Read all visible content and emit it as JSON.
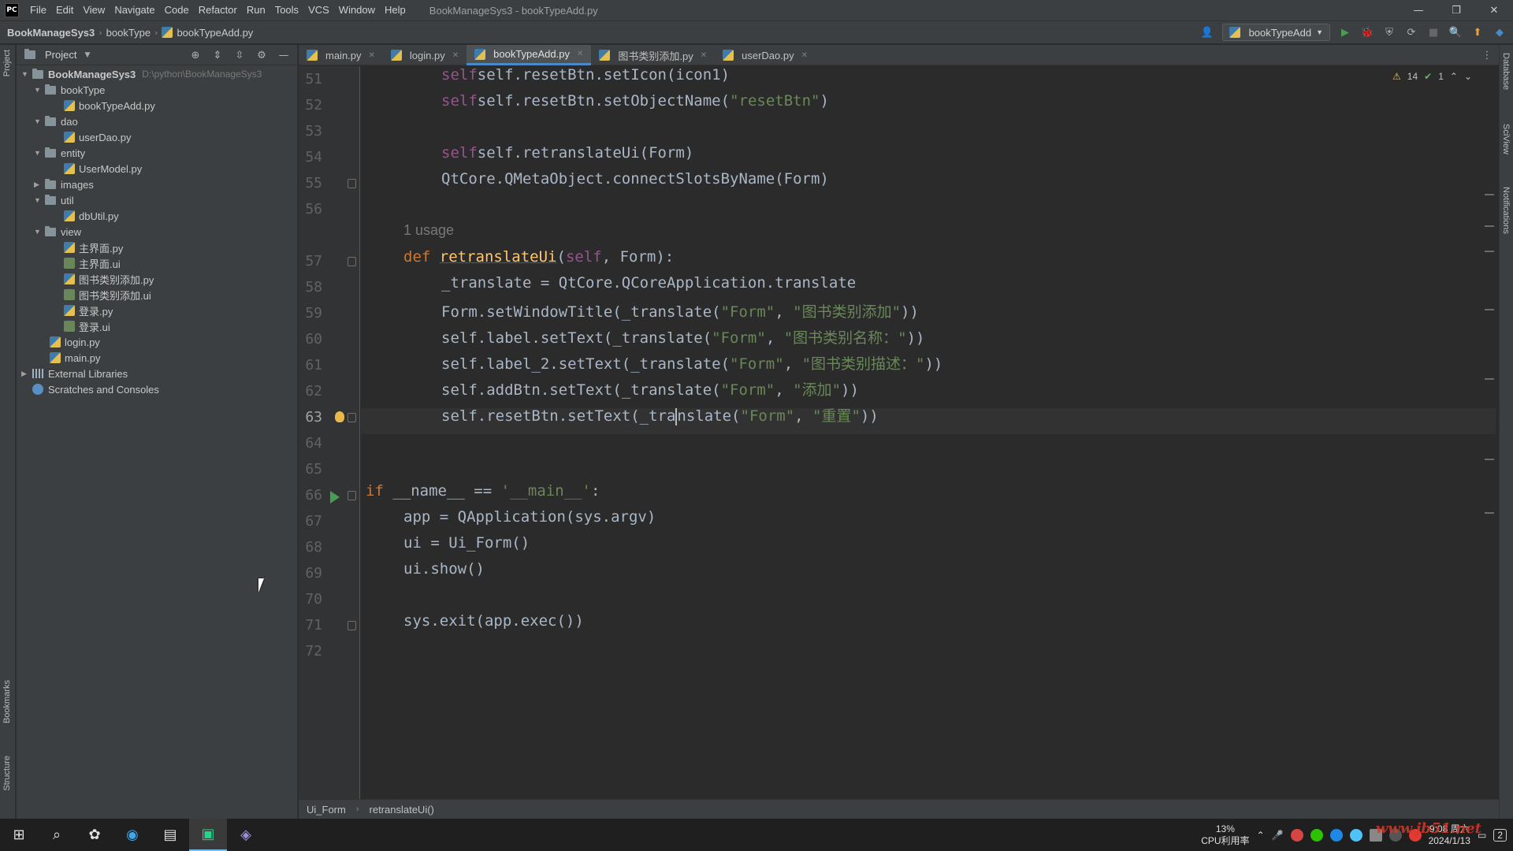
{
  "titlebar": {
    "logo": "PC",
    "menu": [
      "File",
      "Edit",
      "View",
      "Navigate",
      "Code",
      "Refactor",
      "Run",
      "Tools",
      "VCS",
      "Window",
      "Help"
    ],
    "window_title": "BookManageSys3 - bookTypeAdd.py",
    "controls": [
      "—",
      "❐",
      "✕"
    ]
  },
  "navbar": {
    "crumbs": [
      "BookManageSys3",
      "bookType",
      "bookTypeAdd.py"
    ],
    "run_config": "bookTypeAdd"
  },
  "left_stripe": {
    "project": "Project",
    "bookmarks": "Bookmarks",
    "structure": "Structure"
  },
  "right_stripe": {
    "database": "Database",
    "sciview": "SciView",
    "notifications": "Notifications"
  },
  "project": {
    "header": "Project",
    "root": {
      "name": "BookManageSys3",
      "path": "D:\\python\\BookManageSys3"
    },
    "tree": [
      {
        "label": "bookType",
        "kind": "folder",
        "open": true
      },
      {
        "label": "bookTypeAdd.py",
        "kind": "py"
      },
      {
        "label": "dao",
        "kind": "folder",
        "open": true
      },
      {
        "label": "userDao.py",
        "kind": "py"
      },
      {
        "label": "entity",
        "kind": "folder",
        "open": true
      },
      {
        "label": "UserModel.py",
        "kind": "py"
      },
      {
        "label": "images",
        "kind": "folder",
        "open": false
      },
      {
        "label": "util",
        "kind": "folder",
        "open": true
      },
      {
        "label": "dbUtil.py",
        "kind": "py"
      },
      {
        "label": "view",
        "kind": "folder",
        "open": true
      },
      {
        "label": "主界面.py",
        "kind": "py"
      },
      {
        "label": "主界面.ui",
        "kind": "ui"
      },
      {
        "label": "图书类别添加.py",
        "kind": "py"
      },
      {
        "label": "图书类别添加.ui",
        "kind": "ui"
      },
      {
        "label": "登录.py",
        "kind": "py"
      },
      {
        "label": "登录.ui",
        "kind": "ui"
      },
      {
        "label": "login.py",
        "kind": "py"
      },
      {
        "label": "main.py",
        "kind": "py"
      },
      {
        "label": "External Libraries",
        "kind": "lib"
      },
      {
        "label": "Scratches and Consoles",
        "kind": "scratch"
      }
    ]
  },
  "tabs": [
    {
      "label": "main.py",
      "active": false
    },
    {
      "label": "login.py",
      "active": false
    },
    {
      "label": "bookTypeAdd.py",
      "active": true
    },
    {
      "label": "图书类别添加.py",
      "active": false
    },
    {
      "label": "userDao.py",
      "active": false
    }
  ],
  "inspections": {
    "warnings": "14",
    "ok": "1"
  },
  "editor": {
    "line_numbers": [
      "51",
      "52",
      "53",
      "54",
      "55",
      "56",
      "57",
      "58",
      "59",
      "60",
      "61",
      "62",
      "63",
      "64",
      "65",
      "66",
      "67",
      "68",
      "69",
      "70",
      "71",
      "72"
    ],
    "current_line": "63",
    "usage_hint": "1 usage",
    "code": {
      "l51": "self.resetBtn.setIcon(icon1)",
      "l52a": "self.resetBtn.setObjectName(",
      "l52s": "\"resetBtn\"",
      "l52b": ")",
      "l54": "self.retranslateUi(Form)",
      "l55": "QtCore.QMetaObject.connectSlotsByName(Form)",
      "l57": "retranslateUi(self, Form):",
      "l58": "_translate = QtCore.QCoreApplication.translate",
      "l59a": "Form.setWindowTitle(_translate(",
      "l59s1": "\"Form\"",
      "l59s2": "\"图书类别添加\"",
      "l60a": "self.label.setText(_translate(",
      "l60s2": "\"图书类别名称：\"",
      "l61a": "self.label_2.setText(_translate(",
      "l61s2": "\"图书类别描述：\"",
      "l62a": "self.addBtn.setText(_translate(",
      "l62s2": "\"添加\"",
      "l63a": "self.resetBtn.setText(_tra",
      "l63b": "nslate(",
      "l63s2": "\"重置\"",
      "l66kw": "if",
      "l66a": " __name__ == ",
      "l66s": "'__main__'",
      "l66b": ":",
      "l67": "app = QApplication(sys.argv)",
      "l68": "ui = Ui_Form()",
      "l69": "ui.show()",
      "l71": "sys.exit(app.exec())"
    }
  },
  "editor_crumbs": [
    "Ui_Form",
    "retranslateUi()"
  ],
  "taskbar": {
    "cpu_percent": "13%",
    "cpu_label": "CPU利用率",
    "time": "9:08 周六",
    "date": "2024/1/13",
    "notifications": "2",
    "watermark": "www.jb51.net"
  },
  "colors": {
    "keyword": "#cc7832",
    "self": "#94558d",
    "string": "#6a8759",
    "function": "#ffc66d",
    "default_text": "#a9b7c6",
    "accent": "#4a88c7"
  }
}
